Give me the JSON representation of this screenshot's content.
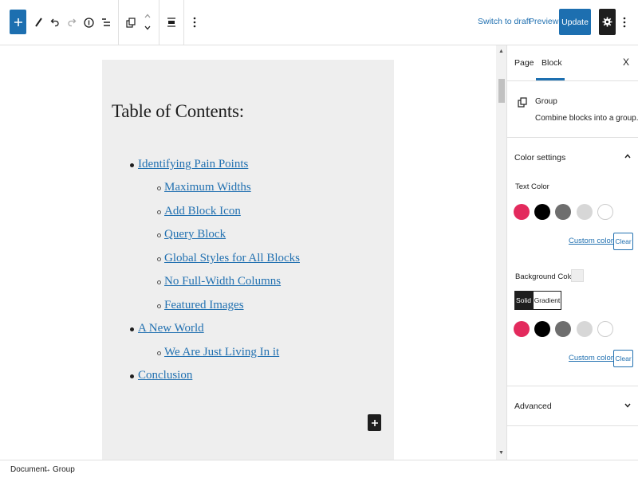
{
  "toolbar": {
    "icons": [
      "plus-icon",
      "pencil-icon",
      "undo-icon",
      "redo-icon",
      "info-icon",
      "list-view-icon",
      "group-icon",
      "move-up-icon",
      "move-down-icon",
      "align-icon",
      "more-vertical-icon"
    ],
    "switch_to_draft": "Switch to draft",
    "preview": "Preview",
    "update": "Update",
    "settings_icon": "gear-icon",
    "options_icon": "more-vertical-icon"
  },
  "editor": {
    "heading": "Table of Contents:",
    "items": [
      {
        "label": "Identifying Pain Points",
        "level": 1
      },
      {
        "label": "Maximum Widths",
        "level": 2
      },
      {
        "label": "Add Block Icon",
        "level": 2
      },
      {
        "label": "Query Block",
        "level": 2
      },
      {
        "label": "Global Styles for All Blocks",
        "level": 2
      },
      {
        "label": "No Full-Width Columns",
        "level": 2
      },
      {
        "label": "Featured Images",
        "level": 2
      },
      {
        "label": "A New World",
        "level": 1
      },
      {
        "label": "We Are Just Living In it",
        "level": 2
      },
      {
        "label": "Conclusion",
        "level": 1
      }
    ],
    "group_background": "#eeeeee",
    "link_color": "#2271b1"
  },
  "sidebar": {
    "tabs": [
      "Page",
      "Block"
    ],
    "active_tab": "Block",
    "close": "X",
    "block": {
      "title": "Group",
      "description": "Combine blocks into a group."
    },
    "color_settings": {
      "title": "Color settings",
      "text_color_label": "Text Color",
      "text_swatches": [
        "#e32a5d",
        "#000000",
        "#6e6e6e",
        "#d7d7d7",
        "#ffffff"
      ],
      "custom_color": "Custom color",
      "clear": "Clear",
      "background_color_label": "Background Color",
      "solid": "Solid",
      "gradient": "Gradient",
      "background_swatches": [
        "#e32a5d",
        "#000000",
        "#6e6e6e",
        "#d7d7d7",
        "#ffffff"
      ]
    },
    "advanced": "Advanced"
  },
  "footer": {
    "breadcrumb": [
      "Document",
      "Group"
    ],
    "separator": "→"
  },
  "accent": "#1d6fb0"
}
